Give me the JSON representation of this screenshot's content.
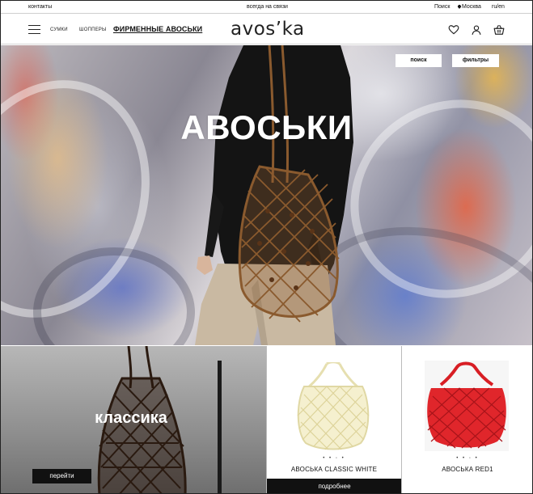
{
  "topbar": {
    "contacts": "контакты",
    "center": "всегда на связи",
    "search": "Поиск",
    "city": "Москва",
    "lang": "ru/en"
  },
  "nav": {
    "bags": "сумки",
    "shoppers": "шопперы",
    "brand": "ФИРМЕННЫЕ АВОСЬКИ",
    "logo": "avos’ka"
  },
  "hero": {
    "title": "АВОСЬКИ",
    "search_button": "поиск",
    "filters_button": "фильтры"
  },
  "classic": {
    "title": "классика",
    "button": "перейти"
  },
  "products": [
    {
      "name": "АВОСЬКА CLASSIC WHITE",
      "dots": "• • ◦ •",
      "button": "подробнее",
      "color": "#f2ecc4"
    },
    {
      "name": "АВОСЬКА RED1",
      "dots": "• • ◦ •",
      "color": "#e0262b"
    }
  ]
}
